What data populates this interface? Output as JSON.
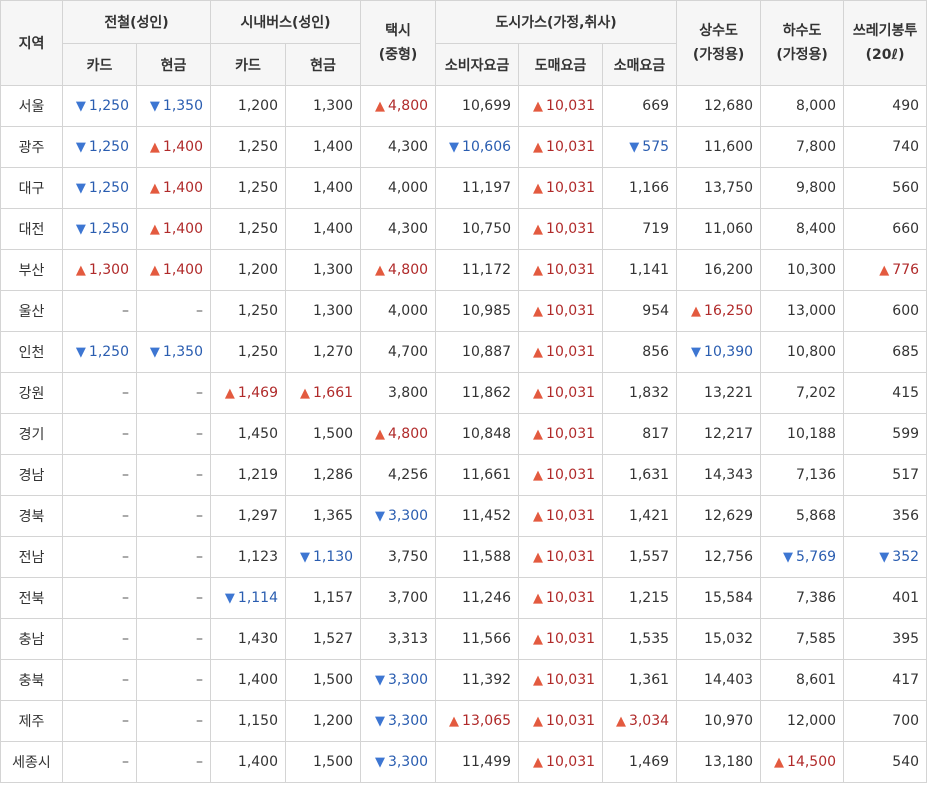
{
  "colors": {
    "up": "#b02a2a",
    "down": "#2a5db0",
    "header_bg": "#f6f6f6",
    "border": "#d4d4d4"
  },
  "icons": {
    "up": "up-triangle-icon",
    "down": "down-triangle-icon"
  },
  "header": {
    "region": "지역",
    "subway": "전철(성인)",
    "bus": "시내버스(성인)",
    "taxi": "택시",
    "taxi_sub": "(중형)",
    "gas": "도시가스(가정,취사)",
    "water": "상수도",
    "water_sub": "(가정용)",
    "sewage": "하수도",
    "sewage_sub": "(가정용)",
    "trash": "쓰레기봉투",
    "trash_sub": "(20ℓ)",
    "card": "카드",
    "cash": "현금",
    "bus_card": "카드",
    "bus_cash": "현금",
    "gas_consumer": "소비자요금",
    "gas_wholesale": "도매요금",
    "gas_retail": "소매요금"
  },
  "rows": [
    {
      "region": "서울",
      "cells": [
        {
          "v": "1,250",
          "t": "down"
        },
        {
          "v": "1,350",
          "t": "down"
        },
        {
          "v": "1,200",
          "t": ""
        },
        {
          "v": "1,300",
          "t": ""
        },
        {
          "v": "4,800",
          "t": "up"
        },
        {
          "v": "10,699",
          "t": ""
        },
        {
          "v": "10,031",
          "t": "up"
        },
        {
          "v": "669",
          "t": ""
        },
        {
          "v": "12,680",
          "t": ""
        },
        {
          "v": "8,000",
          "t": ""
        },
        {
          "v": "490",
          "t": ""
        }
      ]
    },
    {
      "region": "광주",
      "cells": [
        {
          "v": "1,250",
          "t": "down"
        },
        {
          "v": "1,400",
          "t": "up"
        },
        {
          "v": "1,250",
          "t": ""
        },
        {
          "v": "1,400",
          "t": ""
        },
        {
          "v": "4,300",
          "t": ""
        },
        {
          "v": "10,606",
          "t": "down"
        },
        {
          "v": "10,031",
          "t": "up"
        },
        {
          "v": "575",
          "t": "down"
        },
        {
          "v": "11,600",
          "t": ""
        },
        {
          "v": "7,800",
          "t": ""
        },
        {
          "v": "740",
          "t": ""
        }
      ]
    },
    {
      "region": "대구",
      "cells": [
        {
          "v": "1,250",
          "t": "down"
        },
        {
          "v": "1,400",
          "t": "up"
        },
        {
          "v": "1,250",
          "t": ""
        },
        {
          "v": "1,400",
          "t": ""
        },
        {
          "v": "4,000",
          "t": ""
        },
        {
          "v": "11,197",
          "t": ""
        },
        {
          "v": "10,031",
          "t": "up"
        },
        {
          "v": "1,166",
          "t": ""
        },
        {
          "v": "13,750",
          "t": ""
        },
        {
          "v": "9,800",
          "t": ""
        },
        {
          "v": "560",
          "t": ""
        }
      ]
    },
    {
      "region": "대전",
      "cells": [
        {
          "v": "1,250",
          "t": "down"
        },
        {
          "v": "1,400",
          "t": "up"
        },
        {
          "v": "1,250",
          "t": ""
        },
        {
          "v": "1,400",
          "t": ""
        },
        {
          "v": "4,300",
          "t": ""
        },
        {
          "v": "10,750",
          "t": ""
        },
        {
          "v": "10,031",
          "t": "up"
        },
        {
          "v": "719",
          "t": ""
        },
        {
          "v": "11,060",
          "t": ""
        },
        {
          "v": "8,400",
          "t": ""
        },
        {
          "v": "660",
          "t": ""
        }
      ]
    },
    {
      "region": "부산",
      "cells": [
        {
          "v": "1,300",
          "t": "up"
        },
        {
          "v": "1,400",
          "t": "up"
        },
        {
          "v": "1,200",
          "t": ""
        },
        {
          "v": "1,300",
          "t": ""
        },
        {
          "v": "4,800",
          "t": "up"
        },
        {
          "v": "11,172",
          "t": ""
        },
        {
          "v": "10,031",
          "t": "up"
        },
        {
          "v": "1,141",
          "t": ""
        },
        {
          "v": "16,200",
          "t": ""
        },
        {
          "v": "10,300",
          "t": ""
        },
        {
          "v": "776",
          "t": "up"
        }
      ]
    },
    {
      "region": "울산",
      "cells": [
        {
          "v": "–",
          "t": "empty"
        },
        {
          "v": "–",
          "t": "empty"
        },
        {
          "v": "1,250",
          "t": ""
        },
        {
          "v": "1,300",
          "t": ""
        },
        {
          "v": "4,000",
          "t": ""
        },
        {
          "v": "10,985",
          "t": ""
        },
        {
          "v": "10,031",
          "t": "up"
        },
        {
          "v": "954",
          "t": ""
        },
        {
          "v": "16,250",
          "t": "up"
        },
        {
          "v": "13,000",
          "t": ""
        },
        {
          "v": "600",
          "t": ""
        }
      ]
    },
    {
      "region": "인천",
      "cells": [
        {
          "v": "1,250",
          "t": "down"
        },
        {
          "v": "1,350",
          "t": "down"
        },
        {
          "v": "1,250",
          "t": ""
        },
        {
          "v": "1,270",
          "t": ""
        },
        {
          "v": "4,700",
          "t": ""
        },
        {
          "v": "10,887",
          "t": ""
        },
        {
          "v": "10,031",
          "t": "up"
        },
        {
          "v": "856",
          "t": ""
        },
        {
          "v": "10,390",
          "t": "down"
        },
        {
          "v": "10,800",
          "t": ""
        },
        {
          "v": "685",
          "t": ""
        }
      ]
    },
    {
      "region": "강원",
      "cells": [
        {
          "v": "–",
          "t": "empty"
        },
        {
          "v": "–",
          "t": "empty"
        },
        {
          "v": "1,469",
          "t": "up"
        },
        {
          "v": "1,661",
          "t": "up"
        },
        {
          "v": "3,800",
          "t": ""
        },
        {
          "v": "11,862",
          "t": ""
        },
        {
          "v": "10,031",
          "t": "up"
        },
        {
          "v": "1,832",
          "t": ""
        },
        {
          "v": "13,221",
          "t": ""
        },
        {
          "v": "7,202",
          "t": ""
        },
        {
          "v": "415",
          "t": ""
        }
      ]
    },
    {
      "region": "경기",
      "cells": [
        {
          "v": "–",
          "t": "empty"
        },
        {
          "v": "–",
          "t": "empty"
        },
        {
          "v": "1,450",
          "t": ""
        },
        {
          "v": "1,500",
          "t": ""
        },
        {
          "v": "4,800",
          "t": "up"
        },
        {
          "v": "10,848",
          "t": ""
        },
        {
          "v": "10,031",
          "t": "up"
        },
        {
          "v": "817",
          "t": ""
        },
        {
          "v": "12,217",
          "t": ""
        },
        {
          "v": "10,188",
          "t": ""
        },
        {
          "v": "599",
          "t": ""
        }
      ]
    },
    {
      "region": "경남",
      "cells": [
        {
          "v": "–",
          "t": "empty"
        },
        {
          "v": "–",
          "t": "empty"
        },
        {
          "v": "1,219",
          "t": ""
        },
        {
          "v": "1,286",
          "t": ""
        },
        {
          "v": "4,256",
          "t": ""
        },
        {
          "v": "11,661",
          "t": ""
        },
        {
          "v": "10,031",
          "t": "up"
        },
        {
          "v": "1,631",
          "t": ""
        },
        {
          "v": "14,343",
          "t": ""
        },
        {
          "v": "7,136",
          "t": ""
        },
        {
          "v": "517",
          "t": ""
        }
      ]
    },
    {
      "region": "경북",
      "cells": [
        {
          "v": "–",
          "t": "empty"
        },
        {
          "v": "–",
          "t": "empty"
        },
        {
          "v": "1,297",
          "t": ""
        },
        {
          "v": "1,365",
          "t": ""
        },
        {
          "v": "3,300",
          "t": "down"
        },
        {
          "v": "11,452",
          "t": ""
        },
        {
          "v": "10,031",
          "t": "up"
        },
        {
          "v": "1,421",
          "t": ""
        },
        {
          "v": "12,629",
          "t": ""
        },
        {
          "v": "5,868",
          "t": ""
        },
        {
          "v": "356",
          "t": ""
        }
      ]
    },
    {
      "region": "전남",
      "cells": [
        {
          "v": "–",
          "t": "empty"
        },
        {
          "v": "–",
          "t": "empty"
        },
        {
          "v": "1,123",
          "t": ""
        },
        {
          "v": "1,130",
          "t": "down"
        },
        {
          "v": "3,750",
          "t": ""
        },
        {
          "v": "11,588",
          "t": ""
        },
        {
          "v": "10,031",
          "t": "up"
        },
        {
          "v": "1,557",
          "t": ""
        },
        {
          "v": "12,756",
          "t": ""
        },
        {
          "v": "5,769",
          "t": "down"
        },
        {
          "v": "352",
          "t": "down"
        }
      ]
    },
    {
      "region": "전북",
      "cells": [
        {
          "v": "–",
          "t": "empty"
        },
        {
          "v": "–",
          "t": "empty"
        },
        {
          "v": "1,114",
          "t": "down"
        },
        {
          "v": "1,157",
          "t": ""
        },
        {
          "v": "3,700",
          "t": ""
        },
        {
          "v": "11,246",
          "t": ""
        },
        {
          "v": "10,031",
          "t": "up"
        },
        {
          "v": "1,215",
          "t": ""
        },
        {
          "v": "15,584",
          "t": ""
        },
        {
          "v": "7,386",
          "t": ""
        },
        {
          "v": "401",
          "t": ""
        }
      ]
    },
    {
      "region": "충남",
      "cells": [
        {
          "v": "–",
          "t": "empty"
        },
        {
          "v": "–",
          "t": "empty"
        },
        {
          "v": "1,430",
          "t": ""
        },
        {
          "v": "1,527",
          "t": ""
        },
        {
          "v": "3,313",
          "t": ""
        },
        {
          "v": "11,566",
          "t": ""
        },
        {
          "v": "10,031",
          "t": "up"
        },
        {
          "v": "1,535",
          "t": ""
        },
        {
          "v": "15,032",
          "t": ""
        },
        {
          "v": "7,585",
          "t": ""
        },
        {
          "v": "395",
          "t": ""
        }
      ]
    },
    {
      "region": "충북",
      "cells": [
        {
          "v": "–",
          "t": "empty"
        },
        {
          "v": "–",
          "t": "empty"
        },
        {
          "v": "1,400",
          "t": ""
        },
        {
          "v": "1,500",
          "t": ""
        },
        {
          "v": "3,300",
          "t": "down"
        },
        {
          "v": "11,392",
          "t": ""
        },
        {
          "v": "10,031",
          "t": "up"
        },
        {
          "v": "1,361",
          "t": ""
        },
        {
          "v": "14,403",
          "t": ""
        },
        {
          "v": "8,601",
          "t": ""
        },
        {
          "v": "417",
          "t": ""
        }
      ]
    },
    {
      "region": "제주",
      "cells": [
        {
          "v": "–",
          "t": "empty"
        },
        {
          "v": "–",
          "t": "empty"
        },
        {
          "v": "1,150",
          "t": ""
        },
        {
          "v": "1,200",
          "t": ""
        },
        {
          "v": "3,300",
          "t": "down"
        },
        {
          "v": "13,065",
          "t": "up"
        },
        {
          "v": "10,031",
          "t": "up"
        },
        {
          "v": "3,034",
          "t": "up"
        },
        {
          "v": "10,970",
          "t": ""
        },
        {
          "v": "12,000",
          "t": ""
        },
        {
          "v": "700",
          "t": ""
        }
      ]
    },
    {
      "region": "세종시",
      "cells": [
        {
          "v": "–",
          "t": "empty"
        },
        {
          "v": "–",
          "t": "empty"
        },
        {
          "v": "1,400",
          "t": ""
        },
        {
          "v": "1,500",
          "t": ""
        },
        {
          "v": "3,300",
          "t": "down"
        },
        {
          "v": "11,499",
          "t": ""
        },
        {
          "v": "10,031",
          "t": "up"
        },
        {
          "v": "1,469",
          "t": ""
        },
        {
          "v": "13,180",
          "t": ""
        },
        {
          "v": "14,500",
          "t": "up"
        },
        {
          "v": "540",
          "t": ""
        }
      ]
    }
  ]
}
